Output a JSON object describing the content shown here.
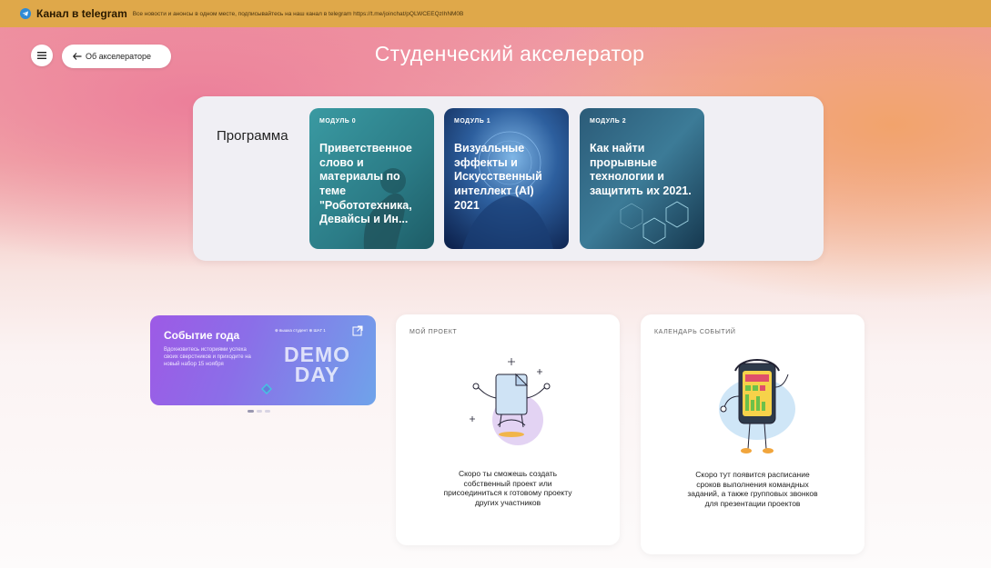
{
  "topbar": {
    "title": "Канал в telegram",
    "text": "Все новости и анонсы в одном месте, подписывайтесь на наш канал в telegram https://t.me/joinchat/pQLWCEEQzIhNM0B"
  },
  "header": {
    "back_label": "Об акселераторе",
    "page_title": "Студенческий акселератор"
  },
  "program": {
    "label": "Программа",
    "modules": [
      {
        "tag": "модуль 0",
        "title": "Приветственное слово и материалы по теме \"Робототехника, Девайсы и Ин..."
      },
      {
        "tag": "модуль 1",
        "title": "Визуальные эффекты и Искусственный интеллект (AI) 2021"
      },
      {
        "tag": "модуль 2",
        "title": "Как найти прорывные технологии и защитить их 2021."
      }
    ]
  },
  "event": {
    "title": "Событие года",
    "description": "Вдохновитесь историями успеха своих сверстников и приходите на новый набор 15 ноября",
    "logos": "⊕ вышка студент  ⊕ ШАГ 1",
    "banner_line1": "DEMO",
    "banner_line2": "DAY"
  },
  "project_card": {
    "heading": "Мой проект",
    "text": "Скоро ты сможешь создать собственный проект или присоединиться к готовому проекту других участников"
  },
  "calendar_card": {
    "heading": "Календарь событий",
    "text": "Скоро тут появится расписание сроков выполнения командных заданий, а также групповых звонков для презентации проектов"
  }
}
